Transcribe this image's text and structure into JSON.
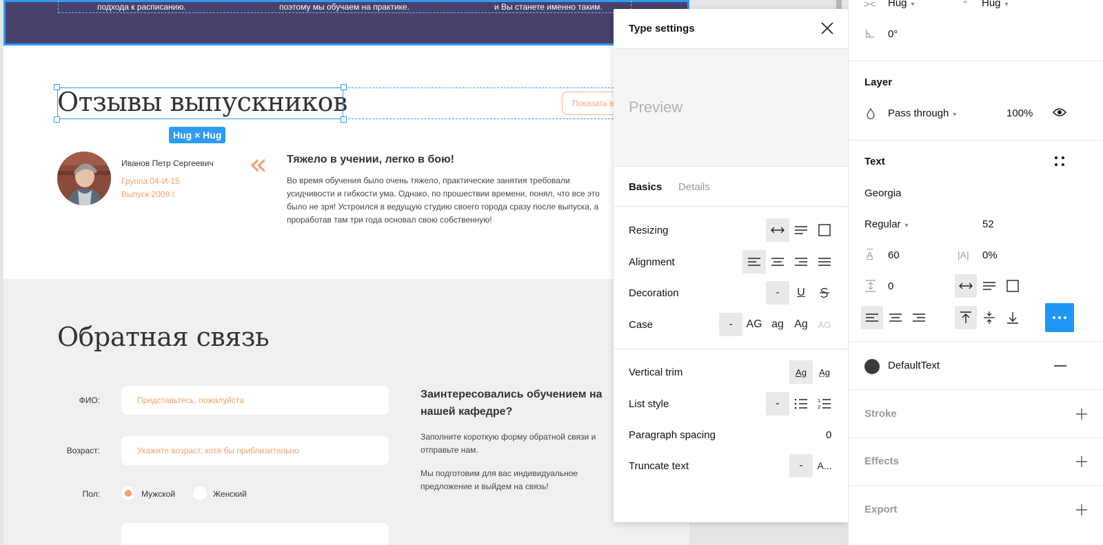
{
  "canvas": {
    "banner_texts": [
      "подхода к расписанию.",
      "поэтому мы обучаем на практике.",
      "и Вы станете именно таким."
    ],
    "reviews_title": "Отзывы выпускников",
    "hug_badge": "Hug × Hug",
    "show_button": "Показать в",
    "reviewer": {
      "name": "Иванов Петр Сергеевич",
      "group": "Группа 04-И-15",
      "year": "Выпуск 2009 г."
    },
    "quote_mark": "«",
    "review": {
      "title": "Тяжело в учении, легко в бою!",
      "text": "Во время обучения было очень тяжело, практические занятия требовали усидчивости и гибкости ума. Однако, по прошествии времени, понял, что все это было не зря! Устроился в ведущую студию своего города сразу после выпуска, а проработав там три года основал свою собственную!"
    },
    "feedback": {
      "title": "Обратная связь",
      "fio_label": "ФИО:",
      "fio_placeholder": "Представьтесь, пожалуйста",
      "age_label": "Возраст:",
      "age_placeholder": "Укажите возраст, хотя бы приблизительно",
      "gender_label": "Пол:",
      "gender_male": "Мужской",
      "gender_female": "Женский",
      "aside_title": "Заинтересовались обучением на нашей кафедре?",
      "aside_text1": "Заполните короткую форму обратной связи и отправьте нам.",
      "aside_text2": "Мы подготовим для вас индивидуальное предложение и выйдем на связь!"
    }
  },
  "popup": {
    "title": "Type settings",
    "preview": "Preview",
    "tabs": [
      "Basics",
      "Details"
    ],
    "active_tab": "Basics",
    "rows": {
      "resizing": "Resizing",
      "alignment": "Alignment",
      "decoration": "Decoration",
      "case": "Case",
      "vertical_trim": "Vertical trim",
      "list_style": "List style",
      "paragraph_spacing": "Paragraph spacing",
      "truncate_text": "Truncate text"
    },
    "case_options": [
      "-",
      "AG",
      "ag",
      "Ag",
      "AG"
    ],
    "decoration_none": "-",
    "decoration_underline": "U",
    "list_none": "-",
    "truncate_none": "-",
    "truncate_option": "A...",
    "paragraph_spacing_value": "0",
    "trim_label": "Ag"
  },
  "panel": {
    "width_mode": "Hug",
    "height_mode": "Hug",
    "rotation": "0°",
    "layer": {
      "title": "Layer",
      "blend": "Pass through",
      "opacity": "100%"
    },
    "text": {
      "title": "Text",
      "font": "Georgia",
      "weight": "Regular",
      "size": "52",
      "line_height": "60",
      "letter_spacing": "0%",
      "paragraph_spacing": "0",
      "line_height_icon": "A",
      "letter_spacing_icon": "|A|"
    },
    "fill": {
      "style_name": "DefaultText",
      "color": "#3a3a3a"
    },
    "stroke_title": "Stroke",
    "effects_title": "Effects",
    "export_title": "Export"
  },
  "colors": {
    "accent": "#1e96f5",
    "selection": "#2d9cf5",
    "banner": "#48416c",
    "orange": "#f4a06e"
  }
}
